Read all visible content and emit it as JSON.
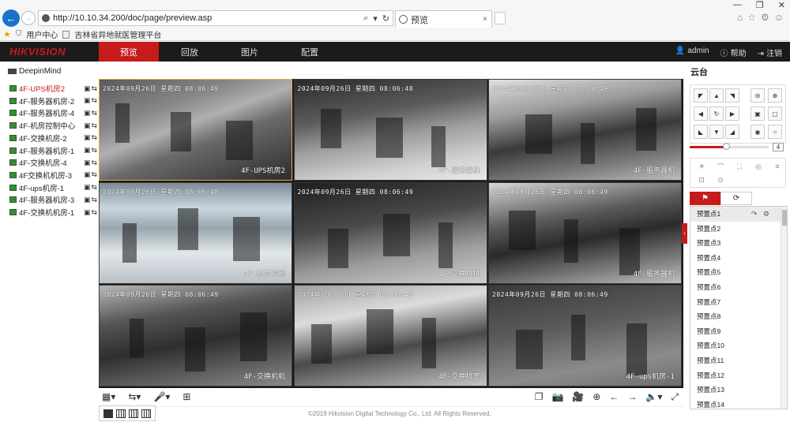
{
  "browser": {
    "url": "http://10.10.34.200/doc/page/preview.asp",
    "tab_title": "预览",
    "tab_close": "×",
    "window_controls": [
      "—",
      "❐",
      "✕"
    ],
    "favorites": [
      "用户中心",
      "吉林省异地就医管理平台"
    ]
  },
  "app": {
    "logo": "HIKVISION",
    "menu": [
      "预览",
      "回放",
      "图片",
      "配置"
    ],
    "user": "admin",
    "help": "帮助",
    "logout": "注销"
  },
  "tree": {
    "root": "DeepinMind",
    "cameras": [
      "4F-UPS机房2",
      "4F-服务器机房-2",
      "4F-服务器机房-4",
      "4F-机房控制中心",
      "4F-交换机房-2",
      "4F-服务器机房-1",
      "4F-交换机房-4",
      "4F交换机机房-3",
      "4F-ups机房-1",
      "4F-服务器机房-3",
      "4F-交换机机房-1"
    ],
    "active_index": 0
  },
  "grid": {
    "tiles": [
      {
        "date": "2024年09月26日  星期四  08:06:49",
        "name": "4F-UPS机房2"
      },
      {
        "date": "2024年09月26日  星期四  08:06:48",
        "name": "4F-服务器机"
      },
      {
        "date": "2024年09月26日  星期四  08:06:49",
        "name": "4F-服务器机"
      },
      {
        "date": "2024年09月26日  星期四  08:06:48",
        "name": "4F-机房控制"
      },
      {
        "date": "2024年09月26日  星期四  08:06:49",
        "name": "4F-交换机机"
      },
      {
        "date": "2024年09月26日  星期四  08:06:49",
        "name": "4F-服务器机"
      },
      {
        "date": "2024年09月26日  星期四  08:06:49",
        "name": "4F-交换机机"
      },
      {
        "date": "2024年09月26日  星期四  08:06:49",
        "name": "4F-交换机房"
      },
      {
        "date": "2024年09月26日  星期四  08:06:49",
        "name": "4F-ups机房-1"
      }
    ],
    "selected_index": 0
  },
  "ptz": {
    "title": "云台",
    "speed": 4,
    "speed_max": 7,
    "preset_tab_icon": "⚑",
    "patrol_tab_icon": "⟳",
    "presets": [
      "预置点1",
      "预置点2",
      "预置点3",
      "预置点4",
      "预置点5",
      "预置点6",
      "预置点7",
      "预置点8",
      "预置点9",
      "预置点10",
      "预置点11",
      "预置点12",
      "预置点13",
      "预置点14"
    ]
  },
  "footer": {
    "copyright": "©2019 Hikvision Digital Technology Co., Ltd. All Rights Reserved."
  }
}
